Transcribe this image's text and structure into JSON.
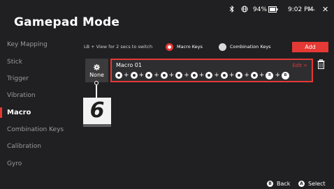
{
  "window": {
    "title": "Gamepad Mode",
    "status": {
      "bluetooth_icon": "bluetooth-icon",
      "network_icon": "globe-icon",
      "battery": "94%",
      "battery_icon": "battery-icon",
      "time": "9:02 PM"
    },
    "minimize_label": "—",
    "close_label": "✕"
  },
  "sidebar": {
    "items": [
      {
        "label": "Key Mapping",
        "active": false
      },
      {
        "label": "Stick",
        "active": false
      },
      {
        "label": "Trigger",
        "active": false
      },
      {
        "label": "Vibration",
        "active": false
      },
      {
        "label": "Macro",
        "active": true
      },
      {
        "label": "Combination Keys",
        "active": false
      },
      {
        "label": "Calibration",
        "active": false
      },
      {
        "label": "Gyro",
        "active": false
      }
    ]
  },
  "main": {
    "hint": "LB + View for 2 secs to switch",
    "mode_options": [
      {
        "label": "Macro Keys",
        "selected": true
      },
      {
        "label": "Combination Keys",
        "selected": false
      }
    ],
    "add_label": "Add",
    "binding": {
      "icon": "gear-icon",
      "label": "None"
    },
    "macro": {
      "name": "Macro 01",
      "edit_label": "Edit >",
      "sequence": [
        "stick-key",
        "stick-key",
        "stick-key",
        "stick-key",
        "stick-key",
        "stick-key",
        "stick-key",
        "stick-key",
        "stick-key",
        "stick-key",
        "R",
        "B"
      ],
      "plus": "+"
    },
    "callout_number": "6"
  },
  "footer": {
    "back": {
      "icon": "B",
      "label": "Back"
    },
    "select": {
      "icon": "A",
      "label": "Select"
    }
  },
  "colors": {
    "accent": "#e53935",
    "background": "#202022"
  }
}
